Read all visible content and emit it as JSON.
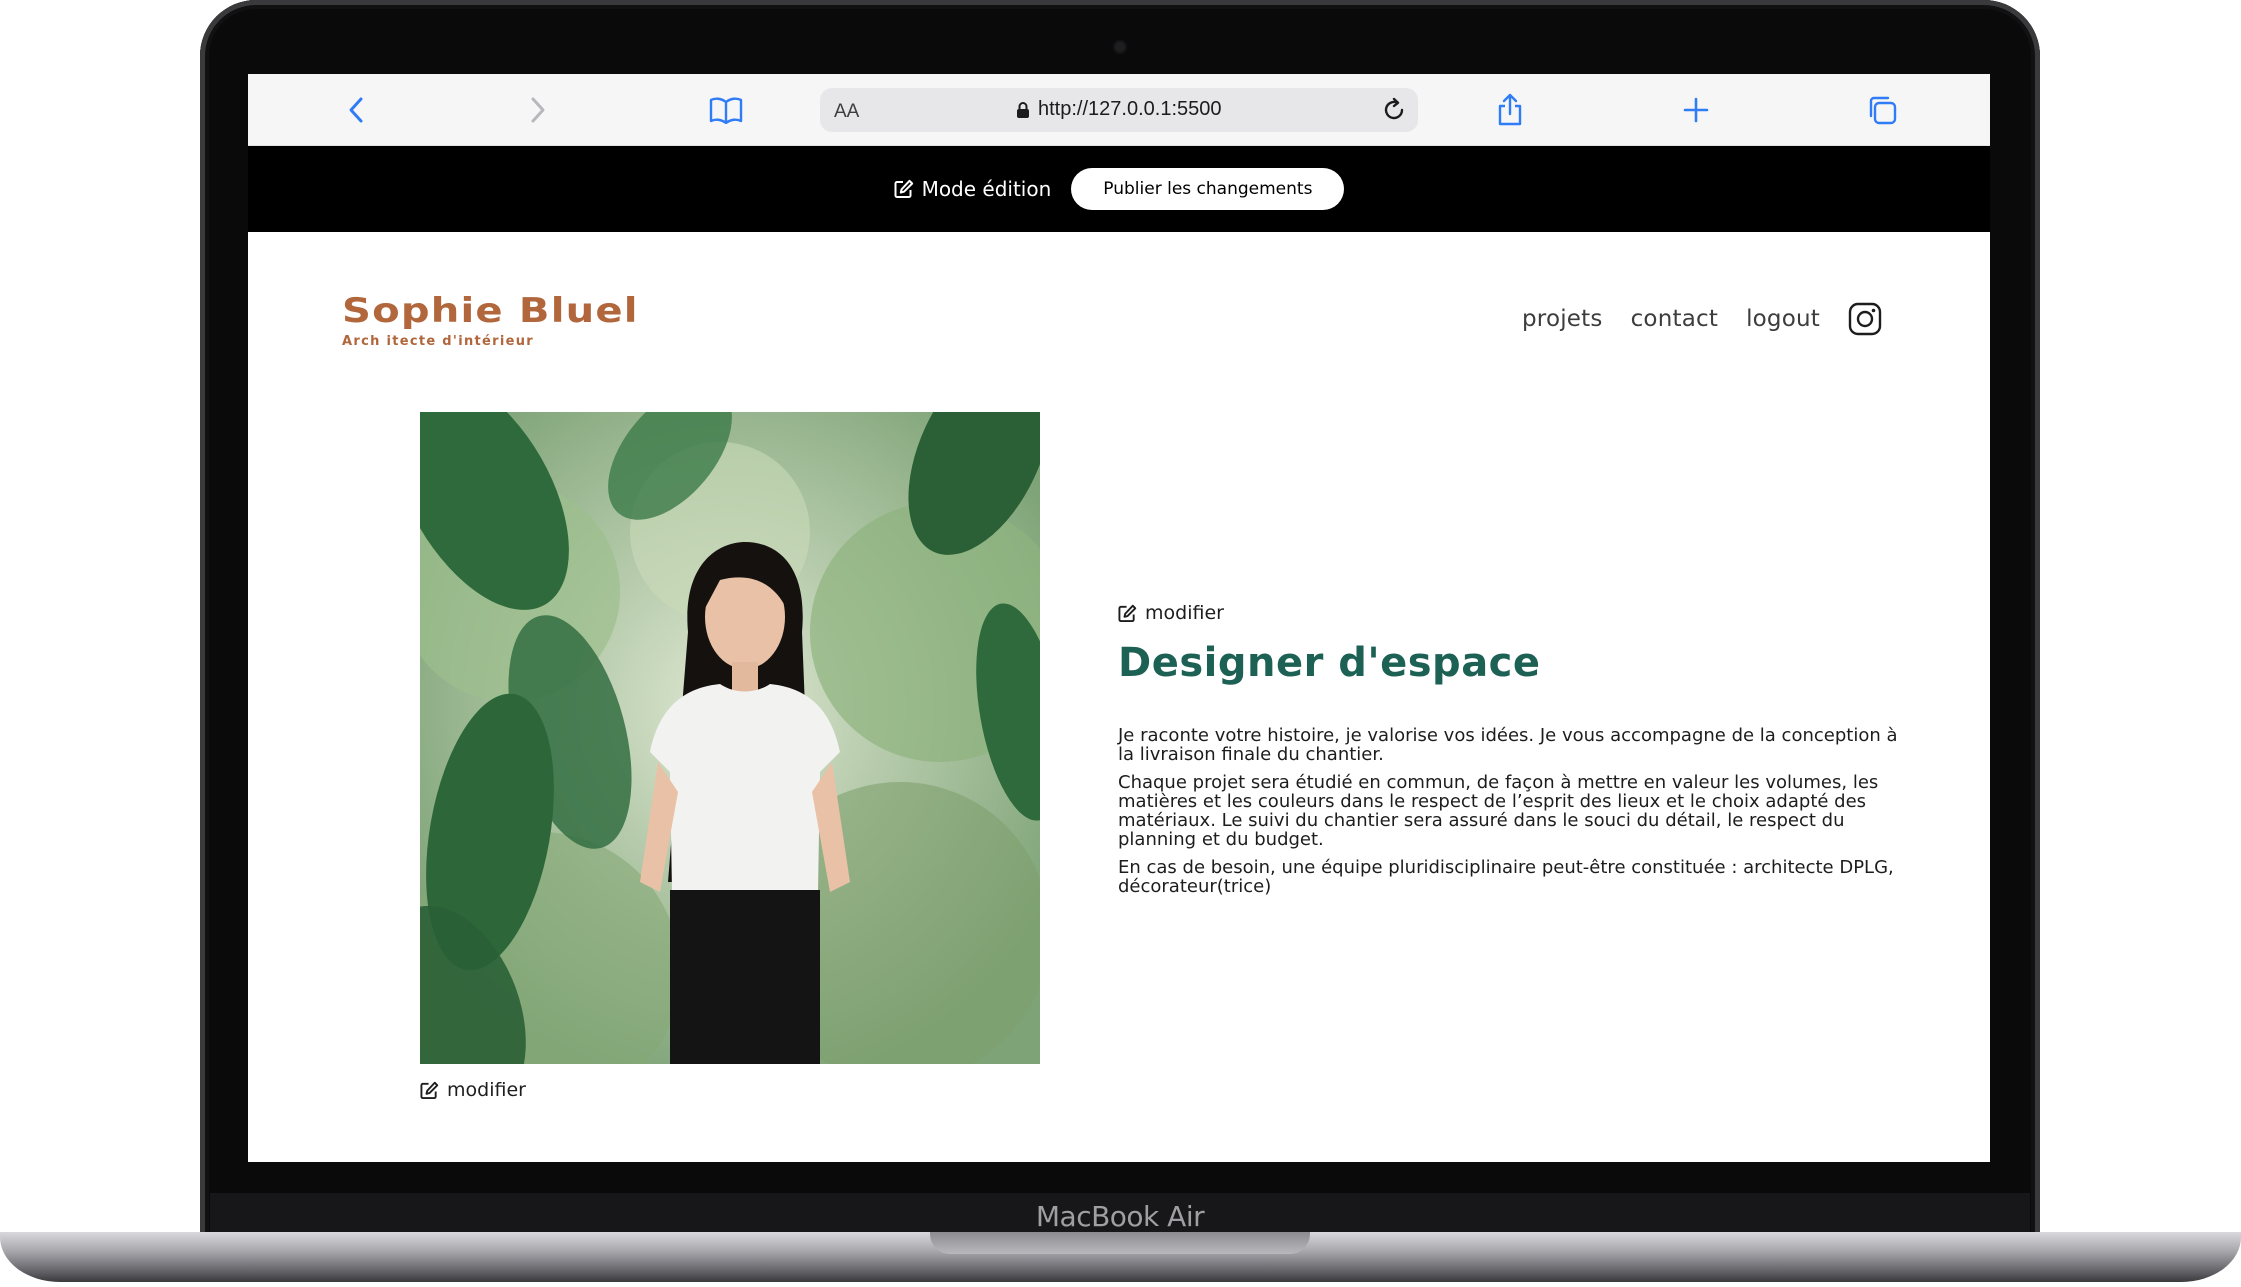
{
  "device": {
    "model_label": "MacBook Air"
  },
  "browser": {
    "text_size_label": "AA",
    "url": "http://127.0.0.1:5500",
    "icons": {
      "back": "chevron-left-icon",
      "forward": "chevron-right-icon",
      "bookmarks": "book-icon",
      "lock": "lock-icon",
      "reload": "reload-icon",
      "share": "share-icon",
      "new_tab": "plus-icon",
      "tabs": "tabs-icon"
    },
    "accent_color": "#2f7cf6"
  },
  "edit_bar": {
    "mode_label": "Mode édition",
    "publish_label": "Publier les changements"
  },
  "header": {
    "logo_title": "Sophie Bluel",
    "logo_subtitle": "Arch itecte d'intérieur",
    "brand_color": "#B1663C",
    "nav": [
      {
        "label": "projets"
      },
      {
        "label": "contact"
      },
      {
        "label": "logout"
      }
    ],
    "instagram_icon": "instagram-icon"
  },
  "introduction": {
    "photo_edit_label": "modifier",
    "text_edit_label": "modifier",
    "title": "Designer d'espace",
    "title_color": "#1D6154",
    "paragraphs": [
      "Je raconte votre histoire, je valorise vos idées. Je vous accompagne de la conception à la livraison finale du chantier.",
      "Chaque projet sera étudié en commun, de façon à mettre en valeur les volumes, les matières et les couleurs dans le respect de l’esprit des lieux et le choix adapté des matériaux. Le suivi du chantier sera assuré dans le souci du détail, le respect du planning et du budget.",
      "En cas de besoin, une équipe pluridisciplinaire peut-être constituée : architecte DPLG, décorateur(trice)"
    ]
  }
}
